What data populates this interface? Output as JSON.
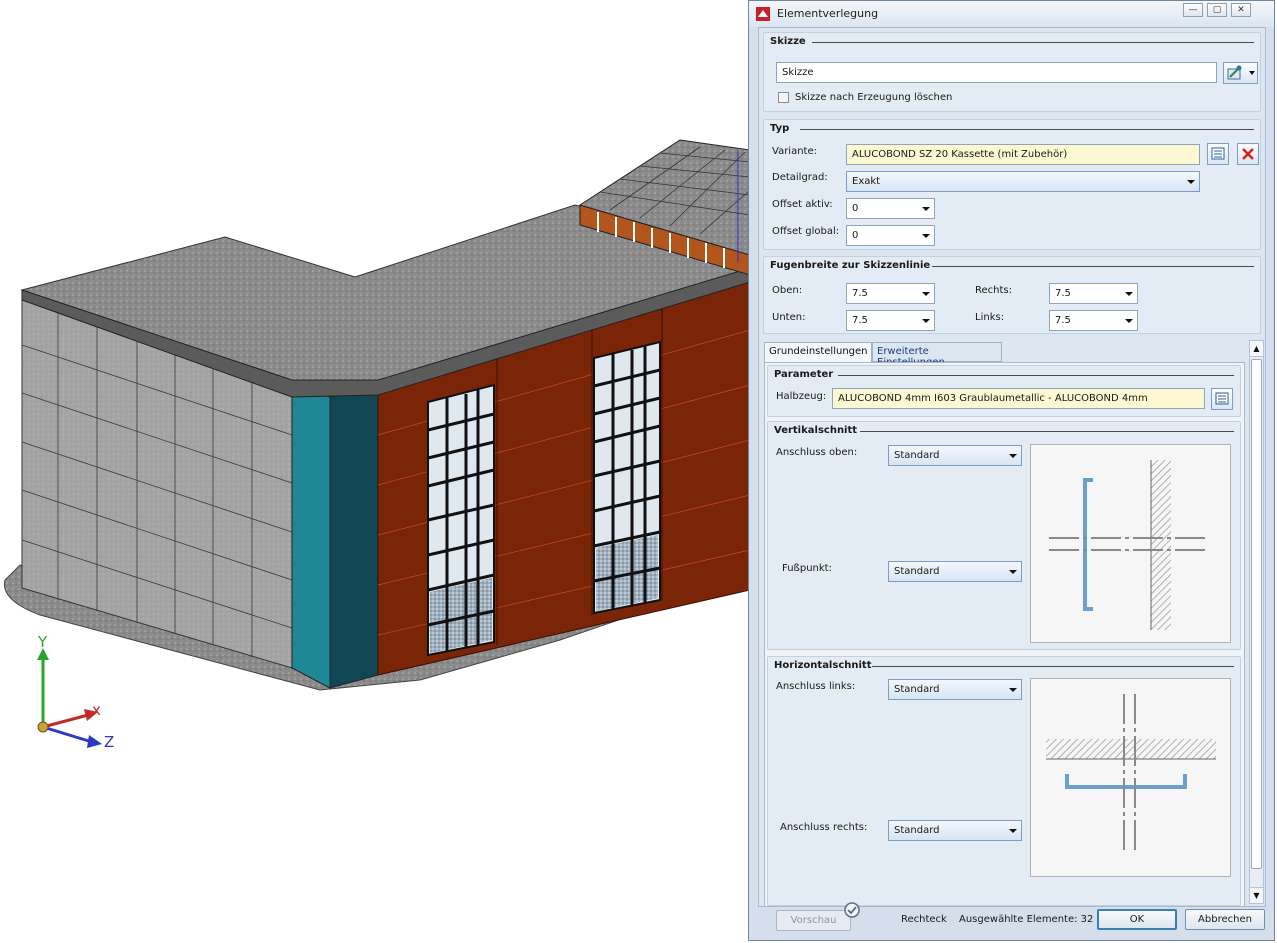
{
  "viewport": {
    "axes": {
      "y": "Y",
      "x": "x",
      "z": "Z"
    }
  },
  "dialog": {
    "title": "Elementverlegung",
    "window_buttons": {
      "minimize": "—",
      "restore": "▢",
      "close": "✕"
    },
    "skizze": {
      "heading": "Skizze",
      "value": "Skizze",
      "delete_after_label": "Skizze nach Erzeugung löschen",
      "delete_after_checked": false
    },
    "typ": {
      "heading": "Typ",
      "variante_label": "Variante:",
      "variante_value": "ALUCOBOND SZ 20 Kassette (mit Zubehör)",
      "detailgrad_label": "Detailgrad:",
      "detailgrad_value": "Exakt",
      "offset_aktiv_label": "Offset aktiv:",
      "offset_aktiv_value": "0",
      "offset_global_label": "Offset global:",
      "offset_global_value": "0"
    },
    "fugen": {
      "heading": "Fugenbreite zur Skizzenlinie",
      "oben_label": "Oben:",
      "oben_value": "7.5",
      "unten_label": "Unten:",
      "unten_value": "7.5",
      "rechts_label": "Rechts:",
      "rechts_value": "7.5",
      "links_label": "Links:",
      "links_value": "7.5"
    },
    "tabs": [
      {
        "label": "Grundeinstellungen",
        "active": true
      },
      {
        "label": "Erweiterte Einstellungen",
        "active": false
      }
    ],
    "parameter": {
      "heading": "Parameter",
      "halbzeug_label": "Halbzeug:",
      "halbzeug_value": "ALUCOBOND 4mm I603 Graublaumetallic - ALUCOBOND 4mm"
    },
    "vertikal": {
      "heading": "Vertikalschnitt",
      "oben_label": "Anschluss oben:",
      "oben_value": "Standard",
      "fuss_label": "Fußpunkt:",
      "fuss_value": "Standard"
    },
    "horizontal": {
      "heading": "Horizontalschnitt",
      "links_label": "Anschluss links:",
      "links_value": "Standard",
      "rechts_label": "Anschluss rechts:",
      "rechts_value": "Standard"
    },
    "footer": {
      "preview_button": "Vorschau",
      "mode_text": "Rechteck",
      "selected_text": "Ausgewählte Elemente: 32",
      "ok_button": "OK",
      "cancel_button": "Abbrechen"
    }
  },
  "colors": {
    "facade_red": "#7a2408",
    "teal": "#1c7e8c",
    "gray_wall": "#9a9a9a",
    "roof": "#8c8c8c",
    "accent_blue": "#6b9fd0"
  }
}
